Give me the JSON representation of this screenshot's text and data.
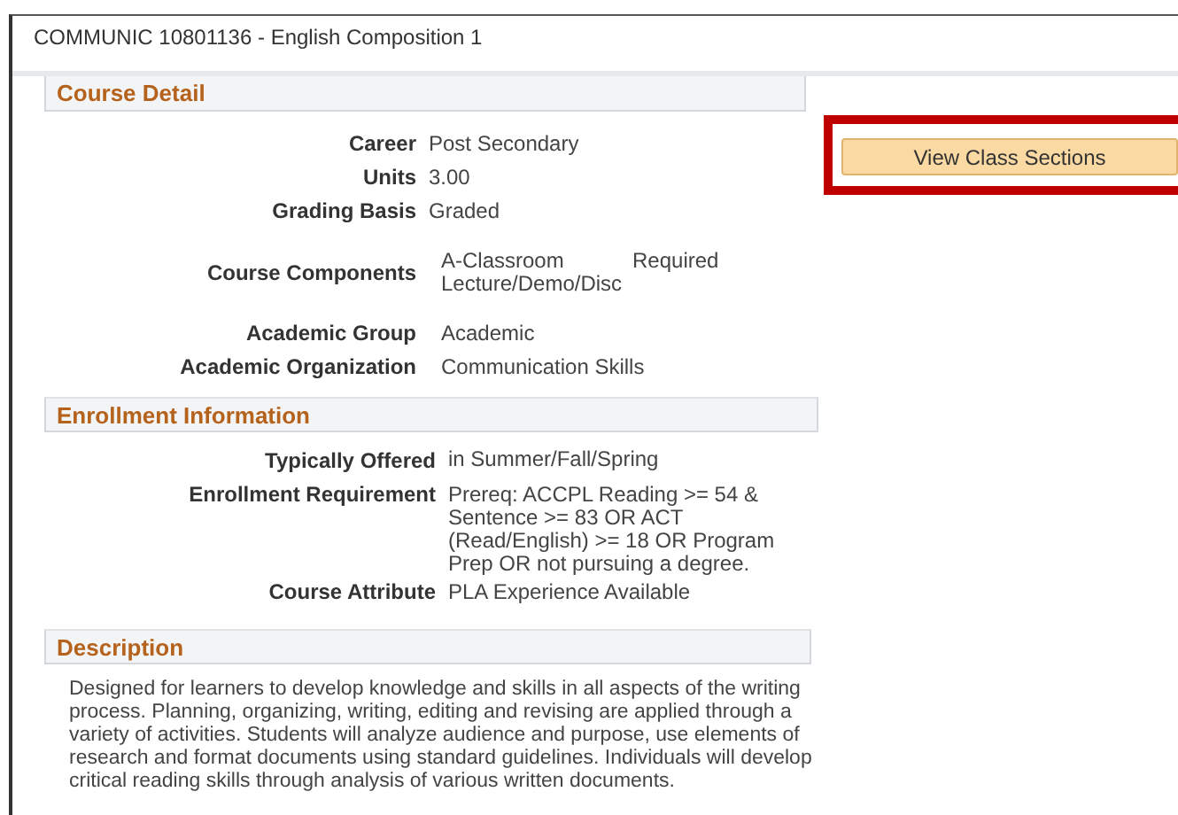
{
  "page_title": "COMMUNIC 10801136 - English Composition 1",
  "course_detail": {
    "heading": "Course Detail",
    "rows": [
      {
        "kind": "plain",
        "label": "Career",
        "value": "Post Secondary"
      },
      {
        "kind": "plain",
        "label": "Units",
        "value": "3.00"
      },
      {
        "kind": "plain",
        "label": "Grading Basis",
        "value": "Graded"
      },
      {
        "kind": "components",
        "label": "Course Components",
        "component": "A-Classroom Lecture/Demo/Disc",
        "status": "Required"
      },
      {
        "kind": "wide",
        "label": "Academic Group",
        "value": "Academic"
      },
      {
        "kind": "wide",
        "label": "Academic Organization",
        "value": "Communication Skills"
      }
    ]
  },
  "view_sections_button": {
    "label": "View Class Sections",
    "highlighted": true
  },
  "enrollment_information": {
    "heading": "Enrollment Information",
    "rows": [
      {
        "label": "Typically Offered",
        "value": "in Summer/Fall/Spring"
      },
      {
        "label": "Enrollment Requirement",
        "value": "Prereq: ACCPL Reading >= 54 & Sentence >= 83 OR ACT (Read/English) >= 18 OR Program Prep OR not pursuing a degree."
      },
      {
        "label": "Course Attribute",
        "value": "PLA Experience Available"
      }
    ]
  },
  "description": {
    "heading": "Description",
    "text": "Designed for learners to develop knowledge and skills in all aspects of the writing process. Planning, organizing, writing, editing and revising are applied through a variety of activities. Students will analyze audience and purpose, use elements of research and format documents using standard guidelines. Individuals will develop critical reading skills through analysis of various written documents."
  }
}
